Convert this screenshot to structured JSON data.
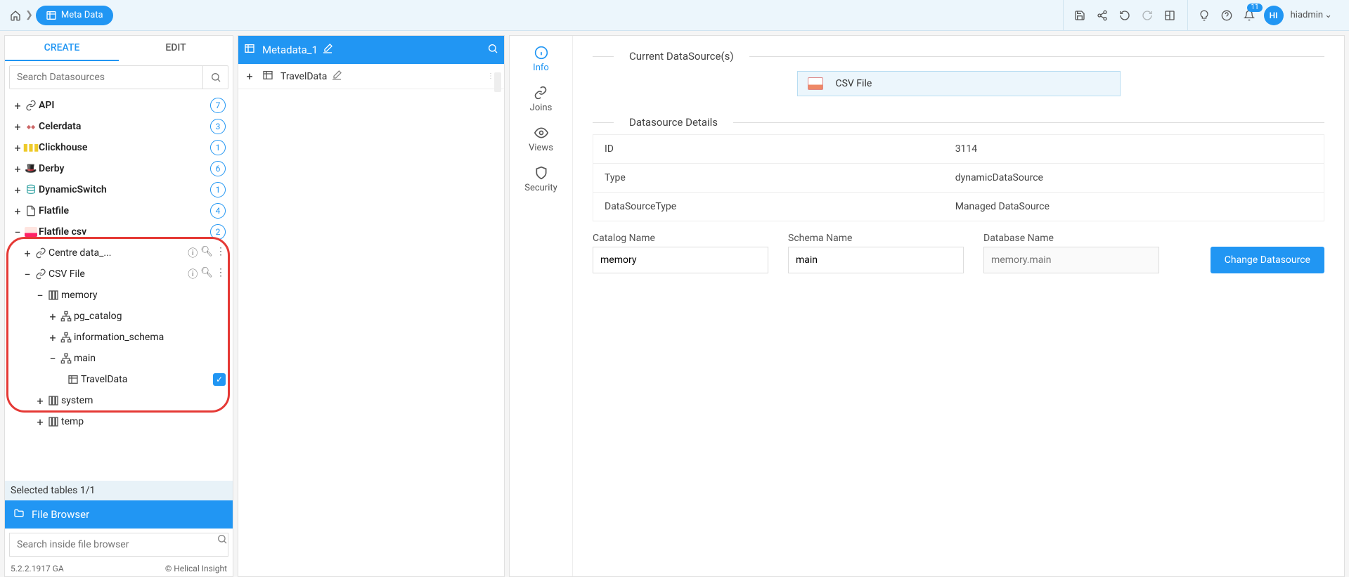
{
  "breadcrumb": {
    "label": "Meta Data"
  },
  "topbar": {
    "notification_count": "11",
    "avatar_initials": "HI",
    "user_name": "hiadmin"
  },
  "left": {
    "tabs": {
      "create": "CREATE",
      "edit": "EDIT"
    },
    "search_placeholder": "Search Datasources",
    "datasources": {
      "api": {
        "label": "API",
        "count": "7"
      },
      "celerdata": {
        "label": "Celerdata",
        "count": "3"
      },
      "clickhouse": {
        "label": "Clickhouse",
        "count": "1"
      },
      "derby": {
        "label": "Derby",
        "count": "6"
      },
      "dynamic": {
        "label": "DynamicSwitch",
        "count": "1"
      },
      "flatfile": {
        "label": "Flatfile",
        "count": "4"
      },
      "flatfilecsv": {
        "label": "Flatfile csv",
        "count": "2"
      },
      "centre": {
        "label": "Centre data_..."
      },
      "csvfile": {
        "label": "CSV File"
      },
      "memory": {
        "label": "memory"
      },
      "pg_catalog": {
        "label": "pg_catalog"
      },
      "information_schema": {
        "label": "information_schema"
      },
      "main": {
        "label": "main"
      },
      "traveldata": {
        "label": "TravelData"
      },
      "system": {
        "label": "system"
      },
      "temp": {
        "label": "temp"
      }
    },
    "selected_tables": "Selected tables 1/1",
    "file_browser": "File Browser",
    "file_search_placeholder": "Search inside file browser",
    "version": "5.2.2.1917 GA",
    "brand": "Helical Insight"
  },
  "mid": {
    "title": "Metadata_1",
    "row1": "TravelData"
  },
  "sidenav": {
    "info": "Info",
    "joins": "Joins",
    "views": "Views",
    "security": "Security"
  },
  "detail": {
    "section1": "Current DataSource(s)",
    "csv_label": "CSV File",
    "section2": "Datasource Details",
    "row_id_label": "ID",
    "row_id_value": "3114",
    "row_type_label": "Type",
    "row_type_value": "dynamicDataSource",
    "row_dst_label": "DataSourceType",
    "row_dst_value": "Managed DataSource",
    "catalog_label": "Catalog Name",
    "catalog_value": "memory",
    "schema_label": "Schema Name",
    "schema_value": "main",
    "database_label": "Database Name",
    "database_placeholder": "memory.main",
    "change_btn": "Change Datasource"
  }
}
